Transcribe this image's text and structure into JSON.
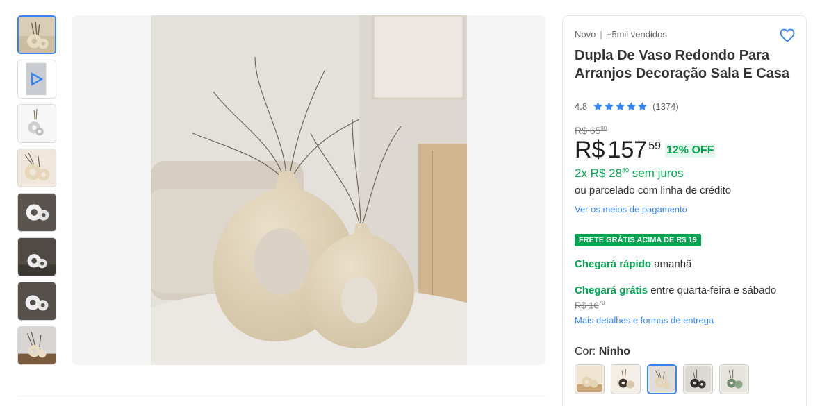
{
  "gallery": {
    "thumbnails": [
      {
        "kind": "photo-vases-beige",
        "active": true
      },
      {
        "kind": "video",
        "icon": "play-icon"
      },
      {
        "kind": "photo-vase-white"
      },
      {
        "kind": "photo-vases-cream"
      },
      {
        "kind": "photo-vases-dark"
      },
      {
        "kind": "photo-vases-dark"
      },
      {
        "kind": "photo-vases-dark"
      },
      {
        "kind": "photo-vases-wood"
      }
    ]
  },
  "product": {
    "condition": "Novo",
    "sold": "+5mil vendidos",
    "title": "Dupla De Vaso Redondo Para Arranjos Decoração Sala E Casa",
    "rating": "4.8",
    "reviews": "(1374)",
    "stars_filled": 5
  },
  "price": {
    "old_integer": "R$ 65",
    "old_cents": "90",
    "currency": "R$",
    "integer": "157",
    "cents": "59",
    "discount": "12% OFF",
    "installments": "2x R$ 28",
    "installments_cents": "80",
    "installments_suffix": "sem juros",
    "credit_line": "ou parcelado com linha de crédito",
    "payment_link": "Ver os meios de pagamento"
  },
  "shipping": {
    "badge": "FRETE GRÁTIS ACIMA DE R$ 19",
    "fast_label": "Chegará rápido",
    "fast_when": "amanhã",
    "free_label": "Chegará grátis",
    "free_when": "entre quarta-feira e sábado",
    "old_integer": "R$ 16",
    "old_cents": "70",
    "details_link": "Mais detalhes e formas de entrega"
  },
  "variant": {
    "label": "Cor:",
    "selected": "Ninho",
    "swatches": [
      {
        "name": "beige-vases"
      },
      {
        "name": "cream-vases"
      },
      {
        "name": "ninho",
        "active": true
      },
      {
        "name": "dark-vases"
      },
      {
        "name": "green-vases"
      }
    ]
  },
  "colors": {
    "accent": "#3483fa",
    "green": "#00a650",
    "vase": "#e2d3b8",
    "star": "#3483fa"
  }
}
